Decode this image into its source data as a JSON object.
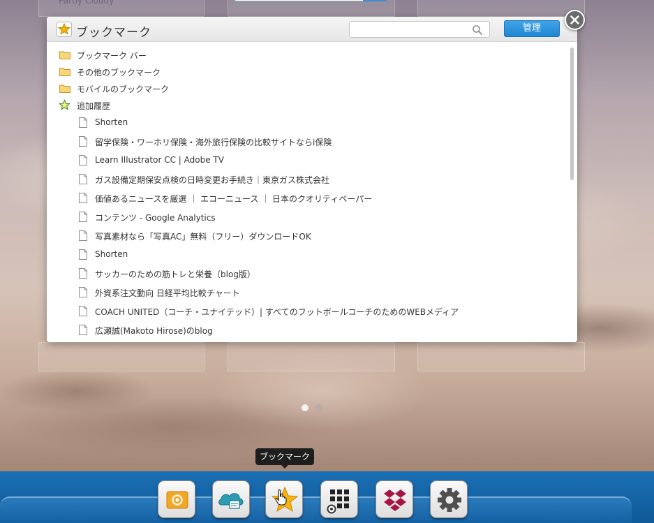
{
  "background": {
    "weather_label": "Partly Cloudy"
  },
  "bookmarks_panel": {
    "title": "ブックマーク",
    "search": {
      "value": "",
      "placeholder": ""
    },
    "manage_label": "管理",
    "folders": [
      {
        "label": "ブックマーク バー",
        "icon": "folder-icon"
      },
      {
        "label": "その他のブックマーク",
        "icon": "folder-icon"
      },
      {
        "label": "モバイルのブックマーク",
        "icon": "folder-icon"
      },
      {
        "label": "追加履歴",
        "icon": "star-icon"
      }
    ],
    "items": [
      "Shorten",
      "留学保険・ワーホリ保険・海外旅行保険の比較サイトならi保険",
      "Learn Illustrator CC | Adobe TV",
      "ガス設備定期保安点検の日時変更お手続き｜東京ガス株式会社",
      "価値あるニュースを厳選 ｜ エコーニュース ｜ 日本のクオリティペーパー",
      "コンテンツ - Google Analytics",
      "写真素材なら「写真AC」無料（フリー）ダウンロードOK",
      "Shorten",
      "サッカーのための筋トレと栄養（blog版）",
      "外資系注文動向 日経平均比較チャート",
      "COACH UNITED（コーチ・ユナイテッド）| すべてのフットボールコーチのためのWEBメディア",
      "広瀬誠(Makoto Hirose)のblog"
    ]
  },
  "dock": {
    "tooltip": "ブックマーク",
    "items": [
      {
        "name": "mail-app",
        "icon": "mail-icon"
      },
      {
        "name": "cloud-app",
        "icon": "cloud-icon"
      },
      {
        "name": "bookmarks-app",
        "icon": "star-icon"
      },
      {
        "name": "apps-app",
        "icon": "apps-grid-icon"
      },
      {
        "name": "dropbox-app",
        "icon": "dropbox-icon"
      },
      {
        "name": "settings-app",
        "icon": "gear-icon"
      }
    ]
  },
  "colors": {
    "accent": "#2a8fd8",
    "dock": "#1565a8",
    "star": "#f5b300"
  }
}
